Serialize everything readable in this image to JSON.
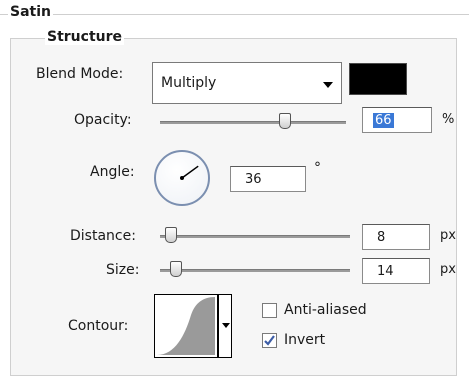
{
  "panel": {
    "title": "Satin",
    "section": "Structure"
  },
  "blend_mode": {
    "label": "Blend Mode:",
    "value": "Multiply",
    "color": "#000000"
  },
  "opacity": {
    "label": "Opacity:",
    "value": "66",
    "unit": "%",
    "slider_fraction": 0.66
  },
  "angle": {
    "label": "Angle:",
    "value": "36",
    "unit": "°",
    "degrees": 36
  },
  "distance": {
    "label": "Distance:",
    "value": "8",
    "unit": "px",
    "slider_fraction": 0.03
  },
  "size": {
    "label": "Size:",
    "value": "14",
    "unit": "px",
    "slider_fraction": 0.05
  },
  "contour": {
    "label": "Contour:",
    "anti_aliased_label": "Anti-aliased",
    "anti_aliased": false,
    "invert_label": "Invert",
    "invert": true
  },
  "colors": {
    "accent_field_fill": "#3a78d6",
    "dial_border": "#7b8fb0",
    "checkbox_check": "#3d5da6"
  }
}
